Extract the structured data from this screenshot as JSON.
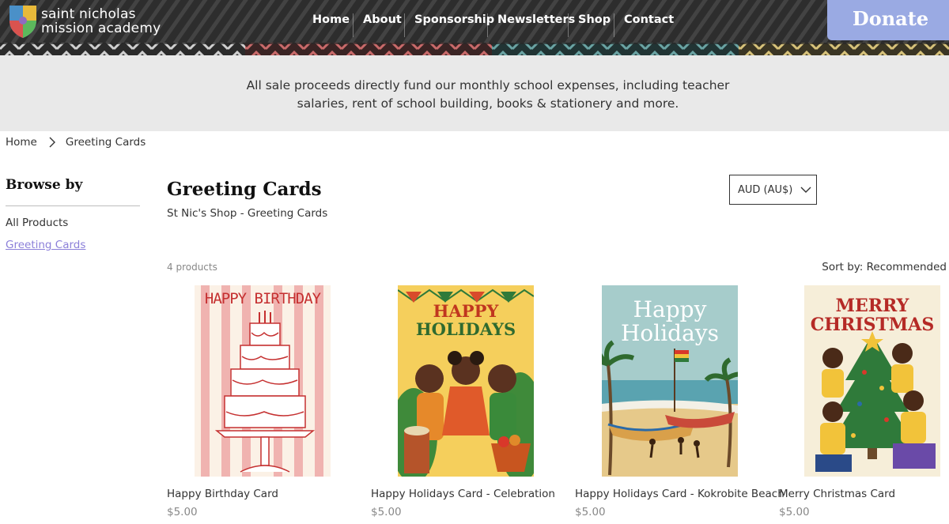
{
  "brand": {
    "line1": "saint nicholas",
    "line2": "mission academy"
  },
  "nav": {
    "items": [
      {
        "label": "Home"
      },
      {
        "label": "About"
      },
      {
        "label": "Sponsorship"
      },
      {
        "label": "Newsletters"
      },
      {
        "label": "Shop"
      },
      {
        "label": "Contact"
      }
    ],
    "donate_label": "Donate"
  },
  "colors": {
    "donate_bg": "#9aaae3",
    "link_active": "#8b7fd9",
    "banner_bg": "#e9e9e9"
  },
  "banner": {
    "text": "All sale proceeds directly fund our monthly school expenses, including teacher salaries, rent of school building, books & stationery and more."
  },
  "breadcrumb": {
    "home": "Home",
    "current": "Greeting Cards",
    "separator_icon": "chevron-right-icon"
  },
  "sidebar": {
    "title": "Browse by",
    "links": [
      {
        "label": "All Products",
        "active": false
      },
      {
        "label": "Greeting Cards",
        "active": true
      }
    ]
  },
  "main": {
    "title": "Greeting Cards",
    "subtitle": "St Nic's Shop - Greeting Cards",
    "currency": "AUD (AU$)",
    "count": "4 products",
    "sort": "Sort by: Recommended"
  },
  "products": [
    {
      "name": "Happy Birthday Card",
      "price": "$5.00",
      "image_text": [
        "HAPPY BIRTHDAY"
      ]
    },
    {
      "name": "Happy Holidays Card - Celebration",
      "price": "$5.00",
      "image_text": [
        "HAPPY",
        "HOLIDAYS"
      ]
    },
    {
      "name": "Happy Holidays Card - Kokrobite Beach",
      "price": "$5.00",
      "image_text": [
        "Happy",
        "Holidays"
      ]
    },
    {
      "name": "Merry Christmas Card",
      "price": "$5.00",
      "image_text": [
        "MERRY",
        "CHRISTMAS"
      ]
    }
  ]
}
